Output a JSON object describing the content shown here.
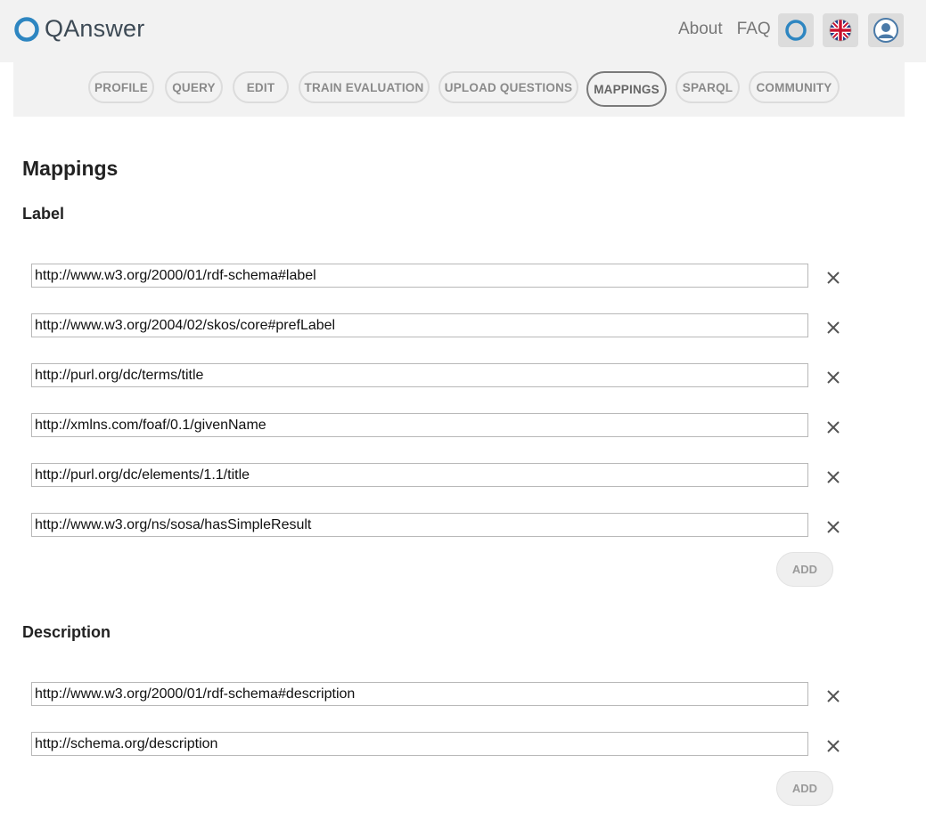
{
  "header": {
    "brand": "QAnswer",
    "nav": [
      "About",
      "FAQ"
    ],
    "icons": [
      "qanswer-logo-icon",
      "uk-flag-icon",
      "user-avatar-icon"
    ]
  },
  "tabs": [
    {
      "label": "PROFILE",
      "active": false
    },
    {
      "label": "QUERY",
      "active": false
    },
    {
      "label": "EDIT",
      "active": false
    },
    {
      "label": "TRAIN EVALUATION",
      "active": false
    },
    {
      "label": "UPLOAD QUESTIONS",
      "active": false
    },
    {
      "label": "MAPPINGS",
      "active": true
    },
    {
      "label": "SPARQL",
      "active": false
    },
    {
      "label": "COMMUNITY",
      "active": false
    }
  ],
  "page_title": "Mappings",
  "sections": [
    {
      "title": "Label",
      "values": [
        "http://www.w3.org/2000/01/rdf-schema#label",
        "http://www.w3.org/2004/02/skos/core#prefLabel",
        "http://purl.org/dc/terms/title",
        "http://xmlns.com/foaf/0.1/givenName",
        "http://purl.org/dc/elements/1.1/title",
        "http://www.w3.org/ns/sosa/hasSimpleResult"
      ],
      "add_label": "ADD"
    },
    {
      "title": "Description",
      "values": [
        "http://www.w3.org/2000/01/rdf-schema#description",
        "http://schema.org/description"
      ],
      "add_label": "ADD"
    }
  ],
  "colors": {
    "header_bg": "#f2f2f2",
    "logo_blue": "#2e86c1",
    "tab_active_border": "#7a7a7a"
  }
}
